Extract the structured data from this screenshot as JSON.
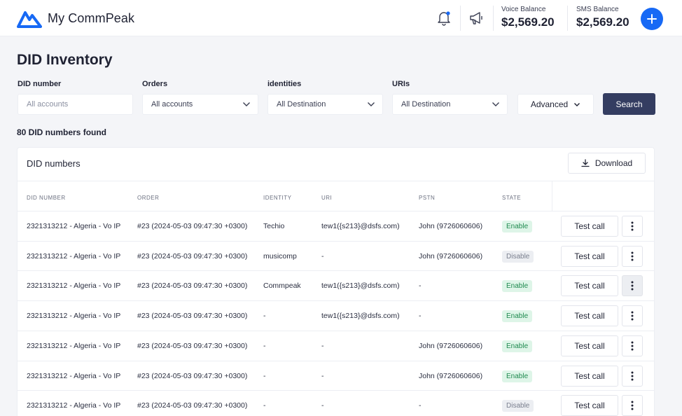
{
  "app": {
    "name": "My CommPeak"
  },
  "header": {
    "notification_icon": "bell-icon",
    "announcement_icon": "megaphone-icon",
    "voice_balance": {
      "label": "Voice Balance",
      "value": "$2,569.20"
    },
    "sms_balance": {
      "label": "SMS Balance",
      "value": "$2,569.20"
    },
    "add_icon": "plus-icon",
    "accent_color": "#1769f5"
  },
  "page": {
    "title": "DID Inventory"
  },
  "filters": {
    "did_number": {
      "label": "DID number",
      "placeholder": "All accounts"
    },
    "orders": {
      "label": "Orders",
      "value": "All accounts"
    },
    "identities": {
      "label": "identities",
      "value": "All Destination"
    },
    "uris": {
      "label": "URIs",
      "value": "All Destination"
    },
    "advanced_label": "Advanced",
    "search_label": "Search",
    "search_color": "#343d61"
  },
  "results": {
    "count_text": "80 DID numbers found"
  },
  "table": {
    "title": "DID numbers",
    "download_label": "Download",
    "columns": [
      "DID NUMBER",
      "ORDER",
      "IDENTITY",
      "URI",
      "PSTN",
      "STATE"
    ],
    "test_call_label": "Test call",
    "rows": [
      {
        "did": "2321313212 - Algeria - Vo IP",
        "order": "#23 (2024-05-03 09:47:30 +0300)",
        "identity": "Techio",
        "uri": "tew1({s213}@dsfs.com)",
        "pstn": "John  (9726060606)",
        "state": "Enable"
      },
      {
        "did": "2321313212 - Algeria - Vo IP",
        "order": "#23 (2024-05-03 09:47:30 +0300)",
        "identity": "musicomp",
        "uri": "-",
        "pstn": "John  (9726060606)",
        "state": "Disable"
      },
      {
        "did": "2321313212 - Algeria - Vo IP",
        "order": "#23 (2024-05-03 09:47:30 +0300)",
        "identity": "Commpeak",
        "uri": "tew1({s213}@dsfs.com)",
        "pstn": "-",
        "state": "Enable"
      },
      {
        "did": "2321313212 - Algeria - Vo IP",
        "order": "#23 (2024-05-03 09:47:30 +0300)",
        "identity": "-",
        "uri": "tew1({s213}@dsfs.com)",
        "pstn": "-",
        "state": "Enable"
      },
      {
        "did": "2321313212 - Algeria - Vo IP",
        "order": "#23 (2024-05-03 09:47:30 +0300)",
        "identity": "-",
        "uri": "-",
        "pstn": "John  (9726060606)",
        "state": "Enable"
      },
      {
        "did": "2321313212 - Algeria - Vo IP",
        "order": "#23 (2024-05-03 09:47:30 +0300)",
        "identity": "-",
        "uri": "-",
        "pstn": "John  (9726060606)",
        "state": "Enable"
      },
      {
        "did": "2321313212 - Algeria - Vo IP",
        "order": "#23 (2024-05-03 09:47:30 +0300)",
        "identity": "-",
        "uri": "-",
        "pstn": "-",
        "state": "Disable"
      }
    ]
  }
}
